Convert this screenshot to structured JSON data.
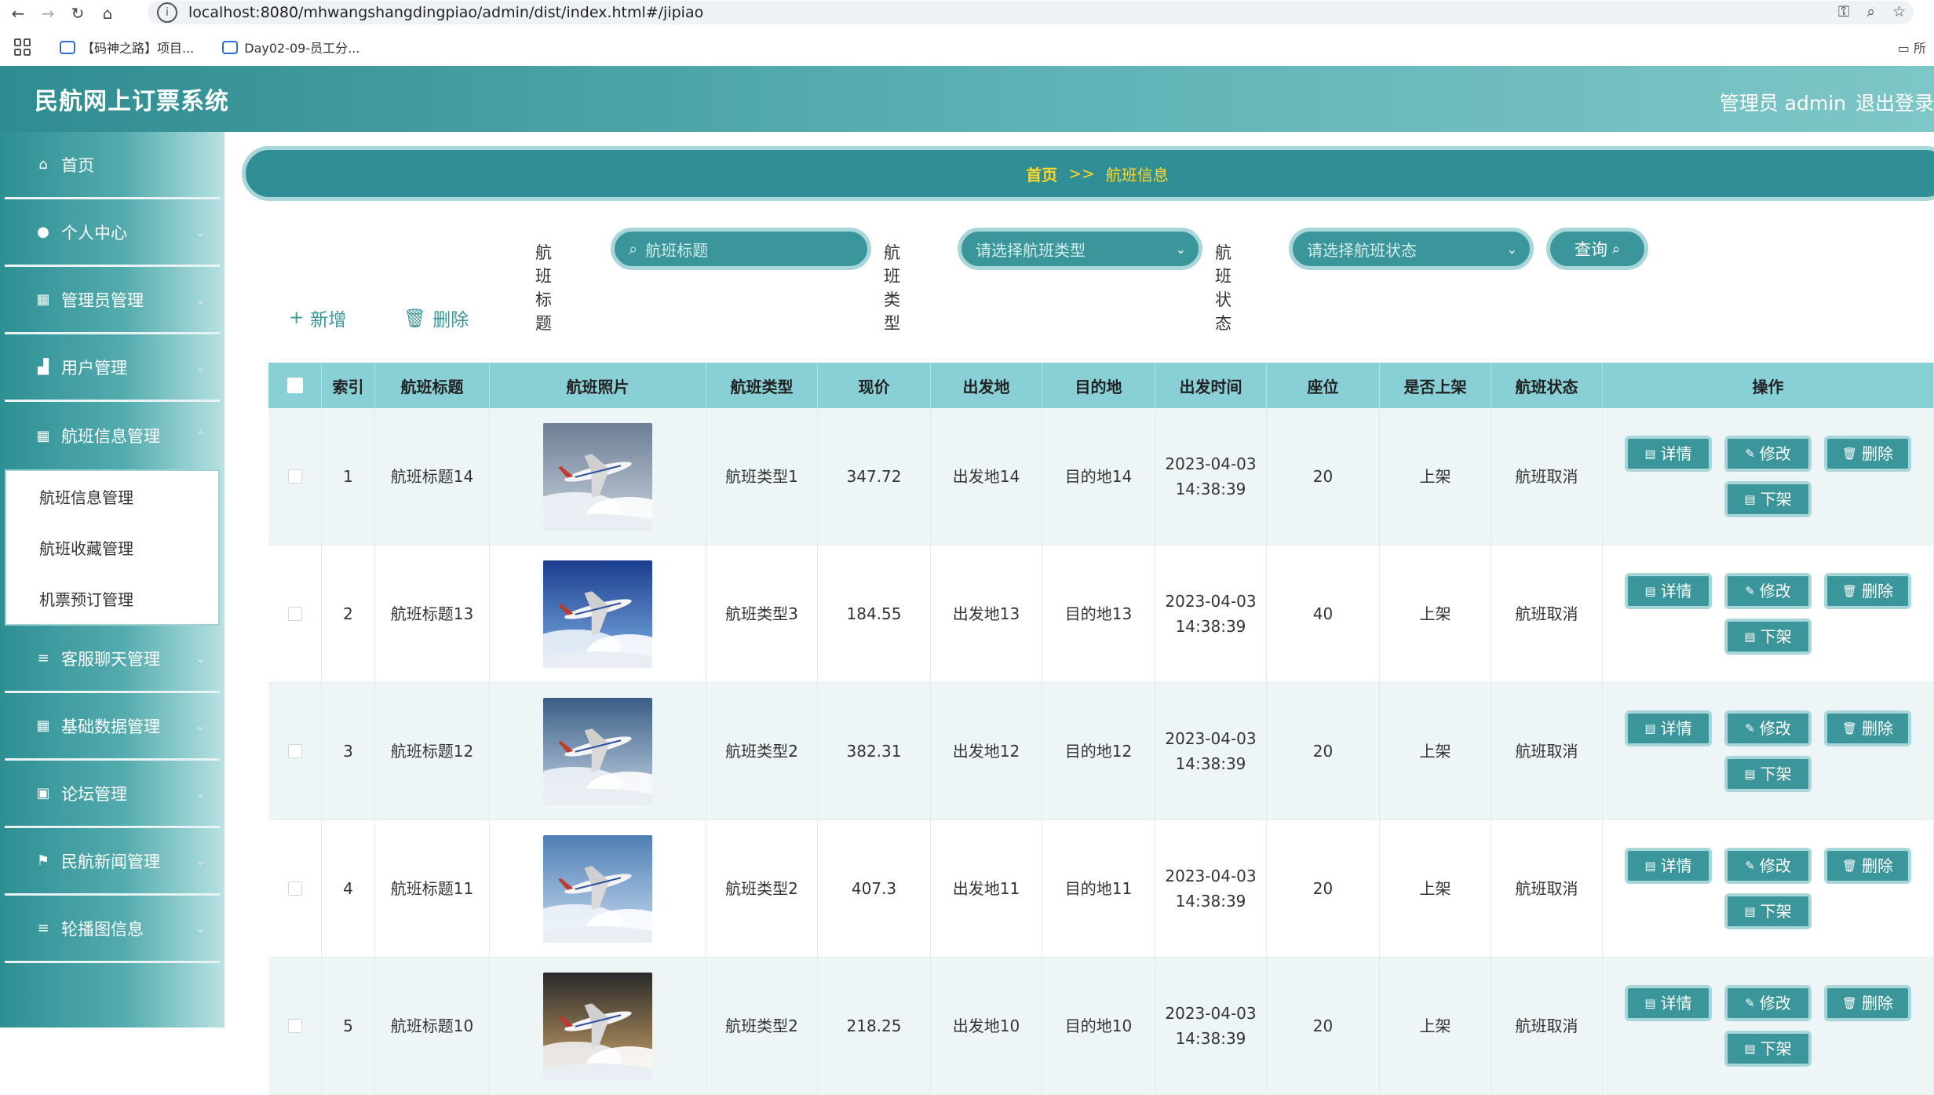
{
  "browser": {
    "url": "localhost:8080/mhwangshangdingpiao/admin/dist/index.html#/jipiao",
    "bookmarks": [
      "【码神之路】项目...",
      "Day02-09-员工分..."
    ],
    "folder_label": "所"
  },
  "app": {
    "title": "民航网上订票系统",
    "user_label": "管理员 admin",
    "logout_label": "退出登录"
  },
  "sidebar": {
    "items": [
      {
        "label": "首页",
        "icon": "home-icon"
      },
      {
        "label": "个人中心",
        "icon": "user-icon"
      },
      {
        "label": "管理员管理",
        "icon": "grid-icon"
      },
      {
        "label": "用户管理",
        "icon": "bulldozer-icon"
      },
      {
        "label": "航班信息管理",
        "icon": "grid-icon"
      },
      {
        "label": "客服聊天管理",
        "icon": "list-icon"
      },
      {
        "label": "基础数据管理",
        "icon": "grid-icon"
      },
      {
        "label": "论坛管理",
        "icon": "notepad-icon"
      },
      {
        "label": "民航新闻管理",
        "icon": "flag-icon"
      },
      {
        "label": "轮播图信息",
        "icon": "list-icon"
      }
    ],
    "submenu": [
      "航班信息管理",
      "航班收藏管理",
      "机票预订管理"
    ]
  },
  "breadcrumb": {
    "home": "首页",
    "separator": ">>",
    "current": "航班信息"
  },
  "search": {
    "title_label": "航班标题",
    "title_placeholder": "航班标题",
    "type_label": "航班类型",
    "type_placeholder": "请选择航班类型",
    "status_label": "航班状态",
    "status_placeholder": "请选择航班状态",
    "query_button": "查询"
  },
  "actions": {
    "add": "新增",
    "delete": "删除"
  },
  "table": {
    "columns": [
      "索引",
      "航班标题",
      "航班照片",
      "航班类型",
      "现价",
      "出发地",
      "目的地",
      "出发时间",
      "座位",
      "是否上架",
      "航班状态",
      "操作"
    ],
    "rows": [
      {
        "index": "1",
        "title": "航班标题14",
        "type": "航班类型1",
        "price": "347.72",
        "from": "出发地14",
        "to": "目的地14",
        "date": "2023-04-03",
        "time": "14:38:39",
        "seats": "20",
        "listed": "上架",
        "status": "航班取消"
      },
      {
        "index": "2",
        "title": "航班标题13",
        "type": "航班类型3",
        "price": "184.55",
        "from": "出发地13",
        "to": "目的地13",
        "date": "2023-04-03",
        "time": "14:38:39",
        "seats": "40",
        "listed": "上架",
        "status": "航班取消"
      },
      {
        "index": "3",
        "title": "航班标题12",
        "type": "航班类型2",
        "price": "382.31",
        "from": "出发地12",
        "to": "目的地12",
        "date": "2023-04-03",
        "time": "14:38:39",
        "seats": "20",
        "listed": "上架",
        "status": "航班取消"
      },
      {
        "index": "4",
        "title": "航班标题11",
        "type": "航班类型2",
        "price": "407.3",
        "from": "出发地11",
        "to": "目的地11",
        "date": "2023-04-03",
        "time": "14:38:39",
        "seats": "20",
        "listed": "上架",
        "status": "航班取消"
      },
      {
        "index": "5",
        "title": "航班标题10",
        "type": "航班类型2",
        "price": "218.25",
        "from": "出发地10",
        "to": "目的地10",
        "date": "2023-04-03",
        "time": "14:38:39",
        "seats": "20",
        "listed": "上架",
        "status": "航班取消"
      }
    ],
    "op_labels": {
      "detail": "详情",
      "edit": "修改",
      "delete": "删除",
      "unlist": "下架"
    }
  },
  "colors": {
    "teal": "#3a969a",
    "header": "#89d0d6",
    "breadcrumb_text": "#ffd62e"
  }
}
